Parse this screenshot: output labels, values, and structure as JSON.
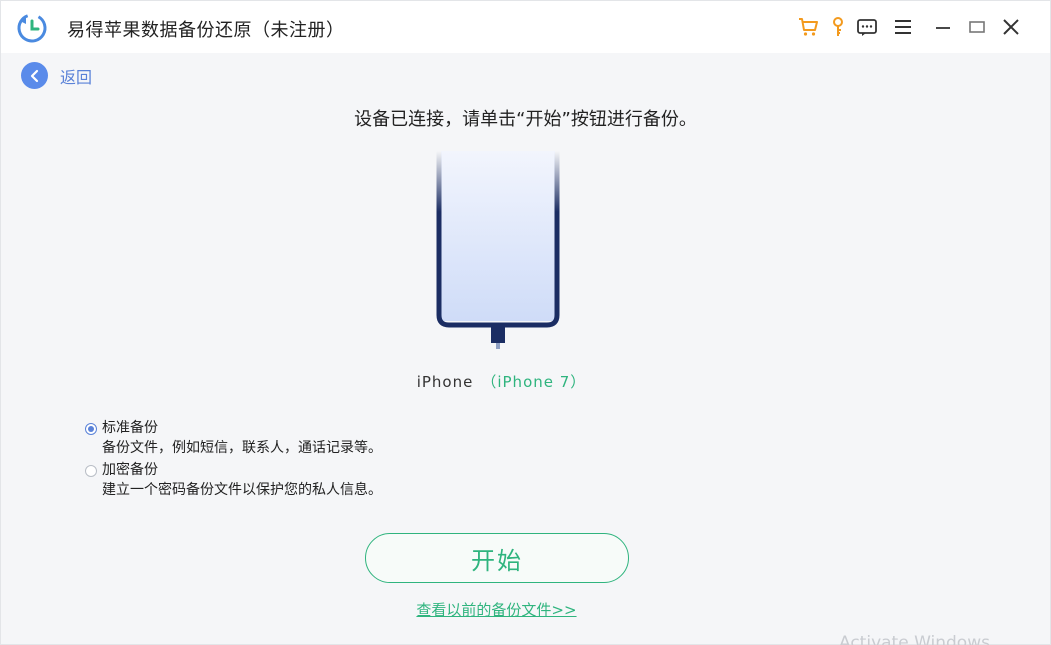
{
  "app": {
    "title": "易得苹果数据备份还原（未注册）",
    "accent_color": "#2fb47e",
    "link_color": "#5a82d8",
    "icons": [
      "app-logo-icon",
      "cart-icon",
      "key-icon",
      "feedback-icon",
      "menu-icon",
      "minimize-icon",
      "maximize-icon",
      "close-icon"
    ]
  },
  "nav": {
    "back_label": "返回"
  },
  "main": {
    "instruction": "设备已连接，请单击“开始”按钮进行备份。",
    "device_name": "iPhone",
    "device_model": "（iPhone 7）"
  },
  "options": [
    {
      "title": "标准备份",
      "description": "备份文件，例如短信，联系人，通话记录等。",
      "selected": true
    },
    {
      "title": "加密备份",
      "description": "建立一个密码备份文件以保护您的私人信息。",
      "selected": false
    }
  ],
  "actions": {
    "start_label": "开始",
    "view_previous_label": "查看以前的备份文件>>"
  },
  "watermark": "Activate Windows"
}
